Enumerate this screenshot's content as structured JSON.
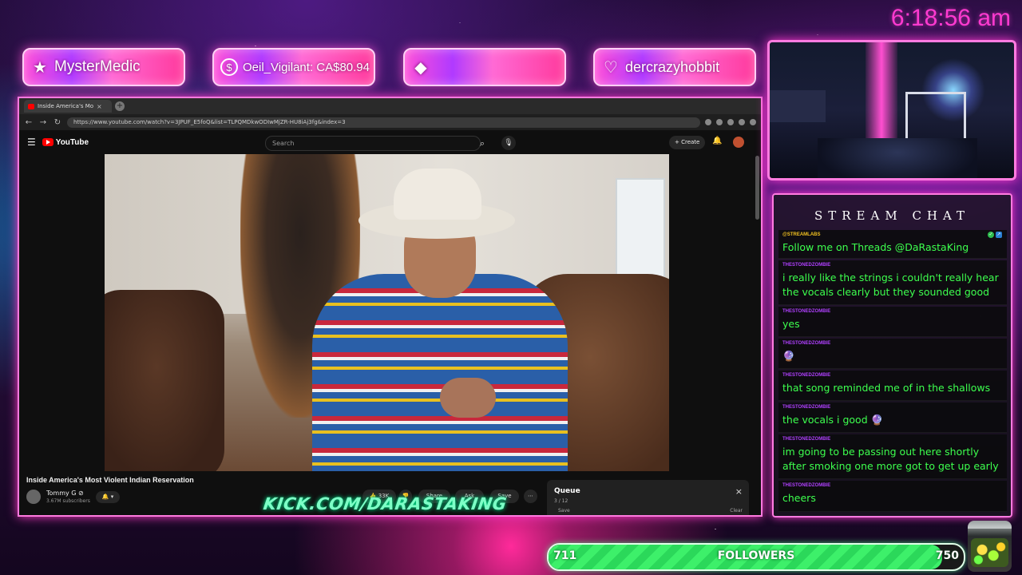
{
  "clock": "6:18:56 am",
  "alerts": [
    {
      "icon": "star-icon",
      "glyph": "★",
      "label": "MysterMedic"
    },
    {
      "icon": "dollar-icon",
      "glyph": "$",
      "label": "Oeil_Vigilant: CA$80.94"
    },
    {
      "icon": "diamond-icon",
      "glyph": "◆",
      "label": ""
    },
    {
      "icon": "heart-icon",
      "glyph": "♡",
      "label": "dercrazyhobbit"
    }
  ],
  "browser": {
    "tab_title": "Inside America's Most Viol",
    "tab_close": "×",
    "url": "https://www.youtube.com/watch?v=3JPUF_E5foQ&list=TLPQMDkwODIwMjZR-HU8iAj3fg&index=3"
  },
  "youtube": {
    "logo_text": "YouTube",
    "search_placeholder": "Search",
    "create_label": "+ Create",
    "video_title": "Inside America's Most Violent Indian Reservation",
    "channel_name": "Tommy G ⊘",
    "channel_subs": "3.67M subscribers",
    "like_label": "33K",
    "share_label": "Share",
    "ask_label": "Ask",
    "save_label": "Save",
    "more_label": "⋯",
    "queue": {
      "title": "Queue",
      "count": "3 / 12",
      "save": "Save",
      "clear": "Clear",
      "close": "×"
    }
  },
  "kick_url": "KICK.COM/DARASTAKING",
  "chat": {
    "title": "STREAM CHAT",
    "messages": [
      {
        "user": "@STREAMLABS",
        "user_color": "#f0c020",
        "text": "Follow me on Threads @DaRastaKing"
      },
      {
        "user": "THESTONEDZOMBIE",
        "user_color": "#b040ff",
        "text": "i really like the strings i couldn't really hear the vocals clearly but they sounded good"
      },
      {
        "user": "THESTONEDZOMBIE",
        "user_color": "#b040ff",
        "text": "yes"
      },
      {
        "user": "THESTONEDZOMBIE",
        "user_color": "#b040ff",
        "text": "🔮"
      },
      {
        "user": "THESTONEDZOMBIE",
        "user_color": "#b040ff",
        "text": "that song reminded me of in the shallows"
      },
      {
        "user": "THESTONEDZOMBIE",
        "user_color": "#b040ff",
        "text": "the vocals i good 🔮"
      },
      {
        "user": "THESTONEDZOMBIE",
        "user_color": "#b040ff",
        "text": "im going to be passing out here shortly after smoking one more got to get up early"
      },
      {
        "user": "THESTONEDZOMBIE",
        "user_color": "#b040ff",
        "text": "cheers"
      }
    ]
  },
  "followers": {
    "current": "711",
    "label": "FOLLOWERS",
    "goal": "750",
    "progress_fraction": 0.948
  },
  "colors": {
    "accent_pink": "#ff3ad0",
    "chat_text": "#3dff4e",
    "follow_bar": "#3df06a",
    "kick_green": "#7dffc6"
  }
}
